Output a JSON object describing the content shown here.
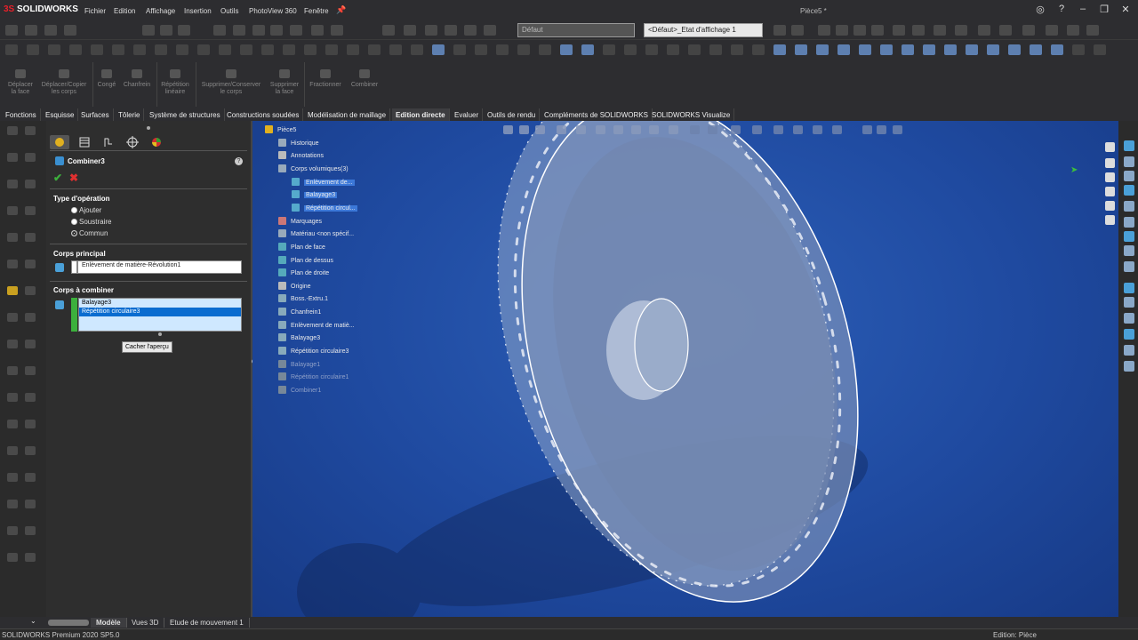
{
  "app": {
    "logo_prefix": "3S",
    "logo": "SOLIDWORKS",
    "doc_title": "Pièce5 *"
  },
  "menu": [
    "Fichier",
    "Edition",
    "Affichage",
    "Insertion",
    "Outils",
    "PhotoView 360",
    "Fenêtre"
  ],
  "toolbar": {
    "config_combo": "Défaut",
    "display_state_combo": "<Défaut>_Etat d'affichage 1"
  },
  "commands": [
    {
      "label": "Déplacer\nla face"
    },
    {
      "label": "Déplacer/Copier\nles corps"
    },
    {
      "label": "Congé"
    },
    {
      "label": "Chanfrein"
    },
    {
      "label": "Répétition\nlinéaire"
    },
    {
      "label": "Supprimer/Conserver\nle corps"
    },
    {
      "label": "Supprimer\nla face"
    },
    {
      "label": "Fractionner"
    },
    {
      "label": "Combiner"
    }
  ],
  "tabs": [
    "Fonctions",
    "Esquisse",
    "Surfaces",
    "Tôlerie",
    "Système de structures",
    "Constructions soudées",
    "Modélisation de maillage",
    "Edition directe",
    "Evaluer",
    "Outils de rendu",
    "Compléments de SOLIDWORKS",
    "SOLIDWORKS Visualize"
  ],
  "active_tab": "Edition directe",
  "property_manager": {
    "title": "Combiner3",
    "help": "?",
    "operation_type_label": "Type d'opération",
    "operations": [
      {
        "label": "Ajouter",
        "selected": false
      },
      {
        "label": "Soustraire",
        "selected": false
      },
      {
        "label": "Commun",
        "selected": true
      }
    ],
    "main_body_label": "Corps principal",
    "main_body_value": "Enlèvement de matière-Révolution1",
    "combine_bodies_label": "Corps à combiner",
    "combine_bodies": [
      {
        "label": "Balayage3",
        "selected": false
      },
      {
        "label": "Répétition circulaire3",
        "selected": true
      }
    ],
    "hide_preview_label": "Cacher l'aperçu"
  },
  "tree": [
    {
      "label": "Pièce5",
      "indent": 0,
      "style": "normal",
      "color": "#e0b020"
    },
    {
      "label": "Historique",
      "indent": 1,
      "style": "normal",
      "color": "#9ab"
    },
    {
      "label": "Annotations",
      "indent": 1,
      "style": "normal",
      "color": "#bbb"
    },
    {
      "label": "Corps volumiques(3)",
      "indent": 1,
      "style": "normal",
      "color": "#9ab"
    },
    {
      "label": "Enlèvement de...",
      "indent": 2,
      "style": "hl",
      "color": "#5ac"
    },
    {
      "label": "Balayage3",
      "indent": 2,
      "style": "hl",
      "color": "#5ac"
    },
    {
      "label": "Répétition circul...",
      "indent": 2,
      "style": "hl",
      "color": "#5ac"
    },
    {
      "label": "Marquages",
      "indent": 1,
      "style": "normal",
      "color": "#c77"
    },
    {
      "label": "Matériau <non spécif...",
      "indent": 1,
      "style": "normal",
      "color": "#9ab"
    },
    {
      "label": "Plan de face",
      "indent": 1,
      "style": "normal",
      "color": "#5ab"
    },
    {
      "label": "Plan de dessus",
      "indent": 1,
      "style": "normal",
      "color": "#5ab"
    },
    {
      "label": "Plan de droite",
      "indent": 1,
      "style": "normal",
      "color": "#5ab"
    },
    {
      "label": "Origine",
      "indent": 1,
      "style": "normal",
      "color": "#bbb"
    },
    {
      "label": "Boss.-Extru.1",
      "indent": 1,
      "style": "normal",
      "color": "#8ab"
    },
    {
      "label": "Chanfrein1",
      "indent": 1,
      "style": "normal",
      "color": "#8ab"
    },
    {
      "label": "Enlèvement de matiè...",
      "indent": 1,
      "style": "normal",
      "color": "#8ab"
    },
    {
      "label": "Balayage3",
      "indent": 1,
      "style": "normal",
      "color": "#8ab"
    },
    {
      "label": "Répétition circulaire3",
      "indent": 1,
      "style": "normal",
      "color": "#8ab"
    },
    {
      "label": "Balayage1",
      "indent": 1,
      "style": "dim",
      "color": "#789"
    },
    {
      "label": "Répétition circulaire1",
      "indent": 1,
      "style": "dim",
      "color": "#789"
    },
    {
      "label": "Combiner1",
      "indent": 1,
      "style": "dim",
      "color": "#789"
    }
  ],
  "bottom_tabs": [
    "Modèle",
    "Vues 3D",
    "Etude de mouvement 1"
  ],
  "status": {
    "left": "SOLIDWORKS Premium 2020 SP5.0",
    "right": "Edition: Pièce"
  }
}
